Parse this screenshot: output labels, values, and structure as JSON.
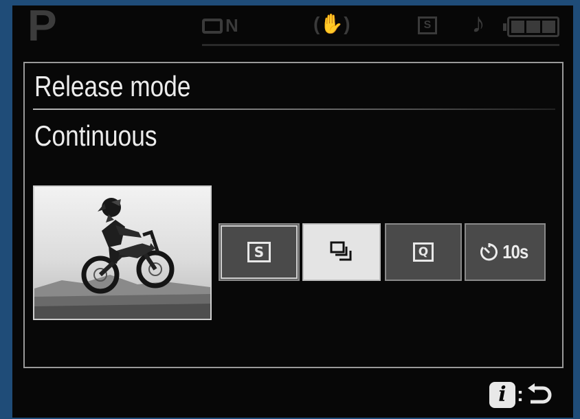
{
  "status_bar": {
    "shooting_mode": "P",
    "image_quality_suffix": "N",
    "release_mode_icon": "S"
  },
  "panel": {
    "title": "Release mode",
    "selected_value": "Continuous"
  },
  "modes": [
    {
      "id": "single",
      "icon": "single-frame-icon",
      "label": "S"
    },
    {
      "id": "continuous",
      "icon": "continuous-icon",
      "selected": true
    },
    {
      "id": "quiet",
      "icon": "quiet-shutter-icon",
      "label": "Q"
    },
    {
      "id": "self_timer",
      "icon": "self-timer-icon",
      "label": "10s"
    }
  ],
  "help": {
    "info_button": "i",
    "separator": ":"
  },
  "colors": {
    "background": "#070707",
    "frame": "#1f4c78",
    "selected": "#e4e4e4",
    "unselected": "#4a4a4a"
  }
}
